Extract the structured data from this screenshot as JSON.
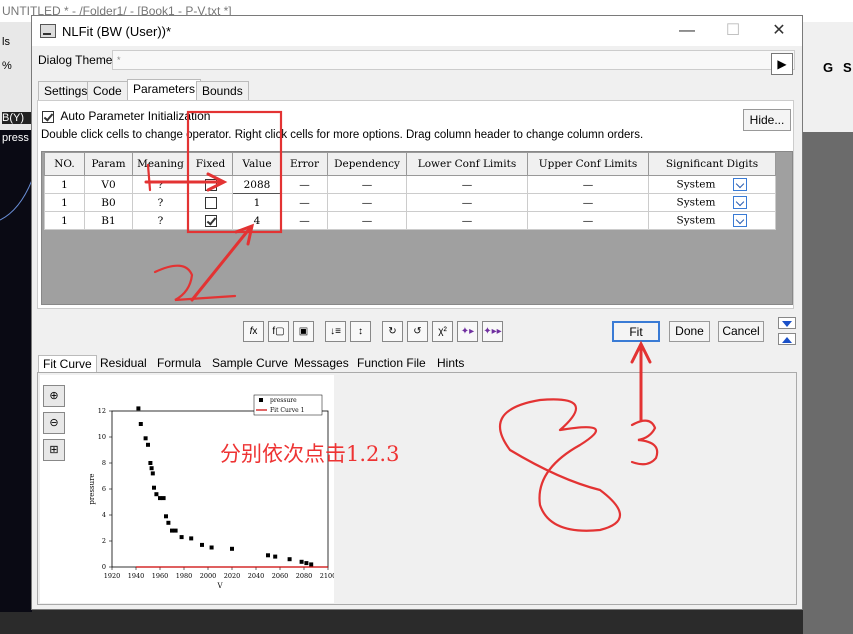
{
  "background": {
    "title": "UNTITLED * - /Folder1/ - [Book1 - P-V.txt *]",
    "left_labels": [
      "ls",
      "%",
      "B(Y)",
      "press"
    ],
    "right_letters": [
      "G",
      "S"
    ]
  },
  "dialog": {
    "title": "NLFit (BW (User))*",
    "theme_label": "Dialog Theme",
    "theme_value": "*",
    "window_buttons": [
      "—",
      "☐",
      "✕"
    ]
  },
  "top_tabs": [
    "Settings",
    "Code",
    "Parameters",
    "Bounds"
  ],
  "active_top_tab": "Parameters",
  "panel": {
    "auto_init_label": "Auto Parameter Initialization",
    "auto_init_checked": true,
    "hint": "Double click cells to change operator. Right click cells for more options. Drag column header to change column orders.",
    "hide_button": "Hide..."
  },
  "table": {
    "headers": [
      "NO.",
      "Param",
      "Meaning",
      "Fixed",
      "Value",
      "Error",
      "Dependency",
      "Lower Conf Limits",
      "Upper Conf Limits",
      "Significant Digits"
    ],
    "rows": [
      {
        "no": "1",
        "param": "V0",
        "meaning": "?",
        "fixed": false,
        "value": "2088",
        "error": "—",
        "dependency": "—",
        "lower": "—",
        "upper": "—",
        "digits": "System"
      },
      {
        "no": "1",
        "param": "B0",
        "meaning": "?",
        "fixed": false,
        "value": "1",
        "error": "—",
        "dependency": "—",
        "lower": "—",
        "upper": "—",
        "digits": "System"
      },
      {
        "no": "1",
        "param": "B1",
        "meaning": "?",
        "fixed": true,
        "value": "4",
        "error": "—",
        "dependency": "—",
        "lower": "—",
        "upper": "—",
        "digits": "System"
      }
    ]
  },
  "toolbar": {
    "icons": [
      "fx-icon",
      "fx-file-icon",
      "save-icon",
      "sort-down-icon",
      "sort-up-icon",
      "iterate-back-icon",
      "iterate-s-icon",
      "chi-square-icon",
      "step-icon",
      "fit-until-converge-icon"
    ],
    "chi_label": "χ²",
    "fit": "Fit",
    "done": "Done",
    "cancel": "Cancel"
  },
  "bottom_tabs": [
    "Fit Curve",
    "Residual",
    "Formula",
    "Sample Curve",
    "Messages",
    "Function File",
    "Hints"
  ],
  "active_bottom_tab": "Fit Curve",
  "annotation": {
    "text": "分别依次点击1.2.3",
    "color": "#e33333"
  },
  "chart_data": {
    "type": "scatter",
    "xlabel": "V",
    "ylabel": "pressure",
    "xlim": [
      1920,
      2100
    ],
    "ylim": [
      0,
      12
    ],
    "xticks": [
      1920,
      1940,
      1960,
      1980,
      2000,
      2020,
      2040,
      2060,
      2080,
      2100
    ],
    "yticks": [
      0,
      2,
      4,
      6,
      8,
      10,
      12
    ],
    "legend": [
      "pressure",
      "Fit Curve 1"
    ],
    "legend_position": "top-right",
    "series": [
      {
        "name": "pressure",
        "x": [
          1942,
          1944,
          1948,
          1950,
          1952,
          1953,
          1954,
          1955,
          1957,
          1960,
          1963,
          1965,
          1967,
          1970,
          1973,
          1978,
          1986,
          1995,
          2003,
          2020,
          2050,
          2056,
          2068,
          2078,
          2082,
          2086
        ],
        "y": [
          12.2,
          11,
          9.9,
          9.4,
          8,
          7.6,
          7.2,
          6.1,
          5.6,
          5.3,
          5.3,
          3.9,
          3.4,
          2.8,
          2.8,
          2.3,
          2.2,
          1.7,
          1.5,
          1.4,
          0.9,
          0.8,
          0.6,
          0.4,
          0.3,
          0.2
        ]
      },
      {
        "name": "Fit Curve 1",
        "x": [
          1940,
          2100
        ],
        "y": [
          0,
          0
        ]
      }
    ]
  }
}
